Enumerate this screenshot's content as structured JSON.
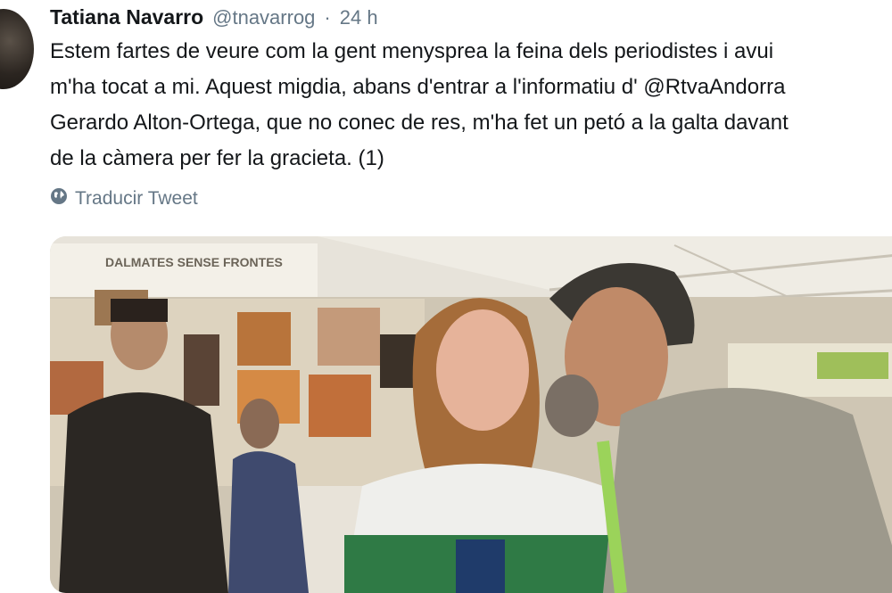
{
  "tweet": {
    "author_name": "Tatiana Navarro",
    "author_handle": "@tnavarrog",
    "separator": "·",
    "time": "24 h",
    "text_lines": [
      "Estem fartes de veure com la gent menysprea la feina dels periodistes i avui",
      "m'ha tocat a mi. Aquest migdia, abans d'entrar a l'informatiu d' @RtvaAndorra",
      "Gerardo Alton-Ortega, que no conec de res, m'ha fet un petó a la galta davant",
      "de la càmera per fer la gracieta. (1)"
    ],
    "translate_label": "Traducir Tweet",
    "translate_icon": "globe-icon"
  },
  "media": {
    "banner_text": "DALMATES SENSE FRONTES"
  }
}
